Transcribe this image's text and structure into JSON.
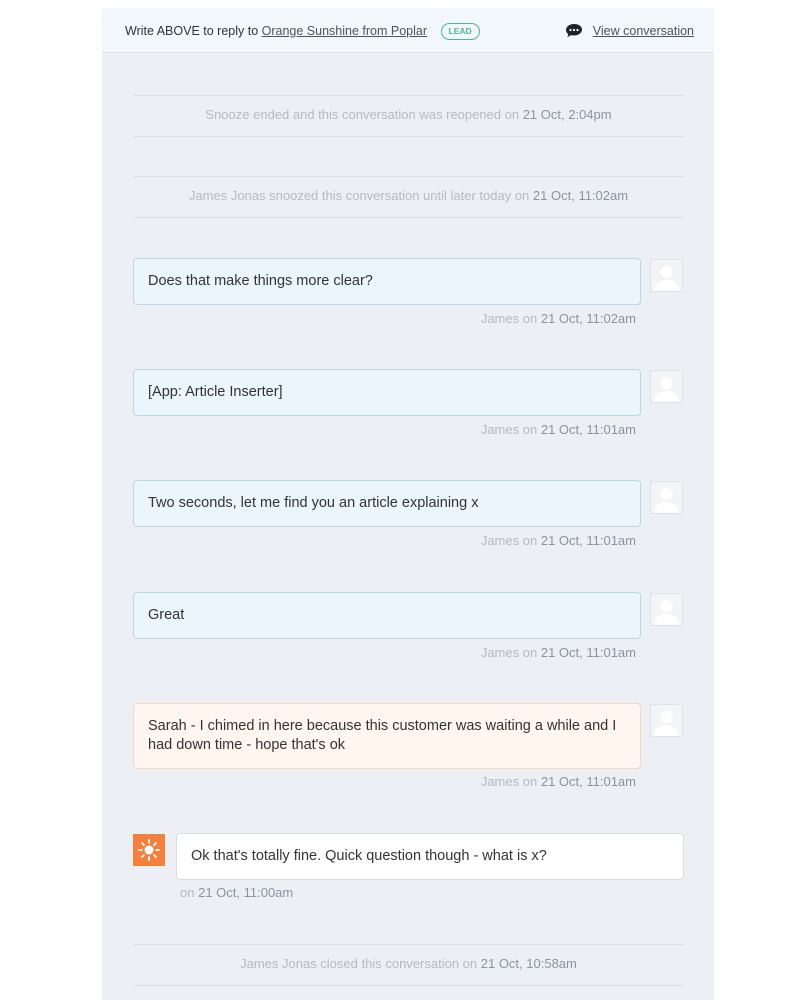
{
  "header": {
    "prompt_prefix": "Write ABOVE to reply to",
    "contact_link": "Orange Sunshine from Poplar",
    "badge": "LEAD",
    "view_conversation": "View conversation",
    "badge_color": "#4cb98a"
  },
  "events": [
    {
      "text": "Snooze ended and this conversation was reopened on",
      "timestamp": "21 Oct, 2:04pm"
    },
    {
      "text": "James Jonas snoozed this conversation until later today on",
      "timestamp": "21 Oct, 11:02am"
    },
    {
      "text": "James Jonas closed this conversation on",
      "timestamp": "21 Oct, 10:58am"
    }
  ],
  "messages": [
    {
      "kind": "admin",
      "text": "Does that make things more clear?",
      "author": "James",
      "on": "on",
      "timestamp": "21 Oct, 11:02am"
    },
    {
      "kind": "admin",
      "text": "[App: Article Inserter]",
      "author": "James",
      "on": "on",
      "timestamp": "21 Oct, 11:01am"
    },
    {
      "kind": "admin",
      "text": "Two seconds, let me find you an article explaining x",
      "author": "James",
      "on": "on",
      "timestamp": "21 Oct, 11:01am"
    },
    {
      "kind": "admin",
      "text": "Great",
      "author": "James",
      "on": "on",
      "timestamp": "21 Oct, 11:01am"
    },
    {
      "kind": "note",
      "text": "Sarah - I chimed in here because this customer was waiting a while and I had down time - hope that's ok",
      "author": "James",
      "on": "on",
      "timestamp": "21 Oct, 11:01am"
    },
    {
      "kind": "user",
      "text": "Ok that's totally fine. Quick question though - what is x?",
      "on": "on",
      "timestamp": "21 Oct, 11:00am"
    }
  ],
  "colors": {
    "panel_bg": "#ecf0f4",
    "admin_bubble": "#eaf5fc",
    "note_bubble": "#fff6ef",
    "user_avatar": "#f5803e"
  },
  "icons": {
    "chat": "chat-bubble-icon",
    "admin_avatar": "default-avatar-icon",
    "user_avatar": "sun-icon"
  }
}
